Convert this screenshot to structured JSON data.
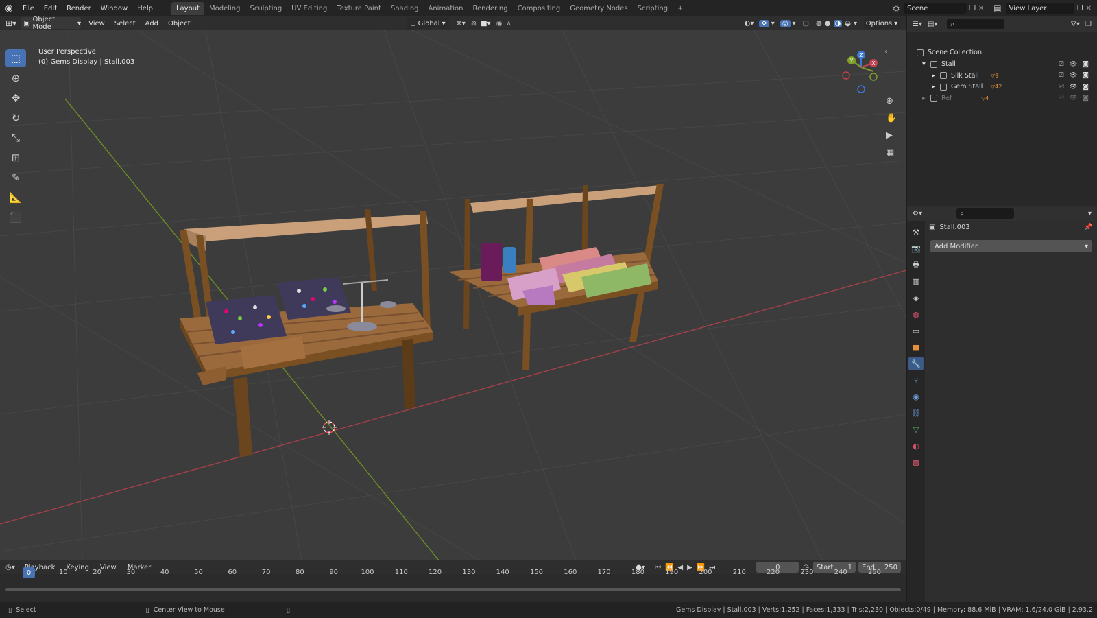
{
  "menu": [
    "File",
    "Edit",
    "Render",
    "Window",
    "Help"
  ],
  "workspaces": [
    "Layout",
    "Modeling",
    "Sculpting",
    "UV Editing",
    "Texture Paint",
    "Shading",
    "Animation",
    "Rendering",
    "Compositing",
    "Geometry Nodes",
    "Scripting"
  ],
  "active_workspace": "Layout",
  "add_workspace": "+",
  "scene_name": "Scene",
  "view_layer": "View Layer",
  "viewport": {
    "mode": "Object Mode",
    "menus": [
      "View",
      "Select",
      "Add",
      "Object"
    ],
    "transform_orientation": "Global",
    "options_label": "Options",
    "overlay_title": "User Perspective",
    "overlay_subtitle": "(0) Gems Display | Stall.003",
    "gizmo_axes": {
      "x": "X",
      "y": "Y",
      "z": "Z"
    }
  },
  "outliner": {
    "root": "Scene Collection",
    "items": [
      {
        "name": "Stall",
        "level": 1,
        "expanded": true
      },
      {
        "name": "Silk Stall",
        "level": 2,
        "expanded": false,
        "badge": "9"
      },
      {
        "name": "Gem Stall",
        "level": 2,
        "expanded": false,
        "badge": "42"
      },
      {
        "name": "Ref",
        "level": 1,
        "expanded": false,
        "badge": "4",
        "dimmed": true
      }
    ]
  },
  "properties": {
    "object_name": "Stall.003",
    "add_modifier": "Add Modifier"
  },
  "timeline": {
    "menus": [
      "Playback",
      "Keying",
      "View",
      "Marker"
    ],
    "current_frame": "0",
    "start_label": "Start",
    "start": "1",
    "end_label": "End",
    "end": "250",
    "ticks": [
      "0",
      "10",
      "20",
      "30",
      "40",
      "50",
      "60",
      "70",
      "80",
      "90",
      "100",
      "110",
      "120",
      "130",
      "140",
      "150",
      "160",
      "170",
      "180",
      "190",
      "200",
      "210",
      "220",
      "230",
      "240",
      "250"
    ]
  },
  "status": {
    "left_action": "Select",
    "mid_action": "Center View to Mouse",
    "stats": "Gems Display | Stall.003 | Verts:1,252 | Faces:1,333 | Tris:2,230 | Objects:0/49 | Memory: 88.6 MiB | VRAM: 1.6/24.0 GiB | 2.93.2"
  },
  "colors": {
    "accent": "#4772b3",
    "x_axis": "#b3434f",
    "y_axis": "#7ea02a",
    "z_axis": "#3d78d6",
    "wood": "#8b5a2b",
    "canvas": "#c9a07a"
  }
}
